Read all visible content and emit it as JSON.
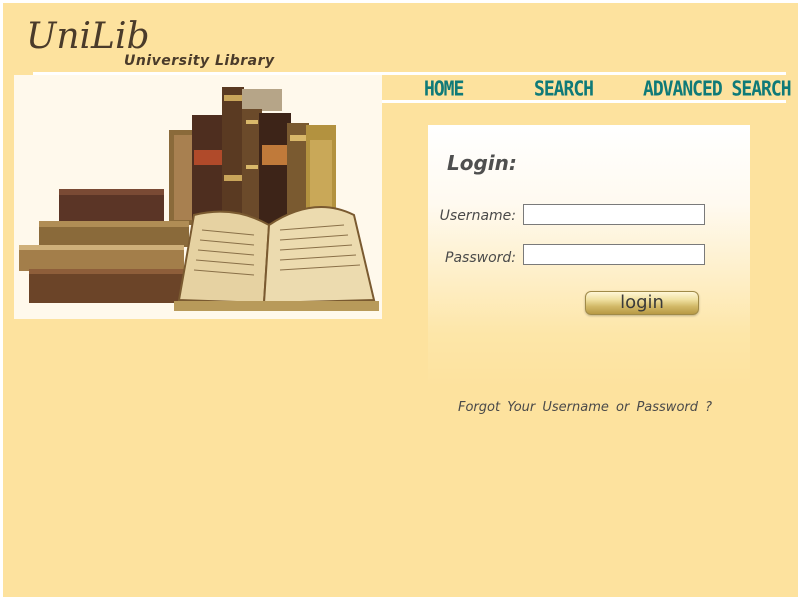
{
  "header": {
    "logo": "UniLib",
    "subtitle": "University Library"
  },
  "nav": {
    "home": "HOME",
    "search": "SEARCH",
    "advanced_search": "ADVANCED SEARCH"
  },
  "login": {
    "title": "Login:",
    "username_label": "Username:",
    "username_value": "",
    "password_label": "Password:",
    "password_value": "",
    "button_label": "login",
    "forgot_link": "Forgot Your Username or Password ?"
  },
  "image": {
    "icon": "antique-books-illustration"
  },
  "colors": {
    "background": "#fde29e",
    "nav_text": "#0f7a78",
    "logo_text": "#4a3b2a"
  }
}
